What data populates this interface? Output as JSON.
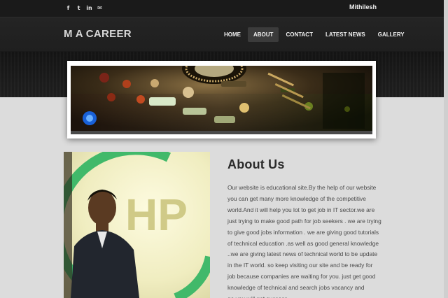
{
  "topbar": {
    "social_icons": [
      {
        "name": "facebook-icon",
        "glyph": "f"
      },
      {
        "name": "twitter-icon",
        "glyph": "t"
      },
      {
        "name": "linkedin-icon",
        "glyph": "in"
      },
      {
        "name": "mail-icon",
        "glyph": "✉"
      }
    ],
    "user_name": "Mithilesh"
  },
  "header": {
    "logo": "M A CAREER",
    "nav": [
      {
        "label": "HOME",
        "active": false
      },
      {
        "label": "ABOUT",
        "active": true
      },
      {
        "label": "CONTACT",
        "active": false
      },
      {
        "label": "LATEST NEWS",
        "active": false
      },
      {
        "label": "GALLERY",
        "active": false
      }
    ]
  },
  "main": {
    "title": "About Us",
    "body": "Our website is educational site.By the help of our website you can get many more knowledge  of the competitive world.And it will help you lot to get job in IT sector.we are just trying to make good path for job seekers . we are trying to give good jobs information . we are giving good tutorials of technical education .as well as good general knowledge ..we are giving latest news of technical world to be update in the IT world. so keep visiting our site and be ready for job because companies are waiting for you. just get good knowledge of technical and search jobs vacancy and go.you will get success........",
    "photo_text": "HP"
  },
  "colors": {
    "header_bg": "#1a1a1a",
    "page_bg": "#dcdcdc",
    "nav_active_bg": "#3b3b3b",
    "title_color": "#2a2a2a"
  }
}
